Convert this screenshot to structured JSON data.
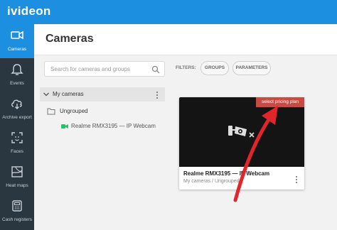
{
  "app": {
    "logo": "ivideon"
  },
  "sidebar": {
    "items": [
      {
        "label": "Cameras",
        "icon": "camera-icon",
        "active": true
      },
      {
        "label": "Events",
        "icon": "bell-icon"
      },
      {
        "label": "Archive export",
        "icon": "cloud-download-icon"
      },
      {
        "label": "Faces",
        "icon": "face-icon"
      },
      {
        "label": "Heat maps",
        "icon": "heatmap-icon"
      },
      {
        "label": "Cash registers",
        "icon": "cash-register-icon"
      }
    ]
  },
  "header": {
    "title": "Cameras"
  },
  "search": {
    "placeholder": "Search for cameras and groups",
    "value": ""
  },
  "filters": {
    "label": "FILTERS:",
    "chips": [
      "GROUPS",
      "PARAMETERS"
    ]
  },
  "tree": {
    "root": "My cameras",
    "group": "Ungrouped",
    "camera": "Realme RMX3195 — IP Webcam"
  },
  "card": {
    "badge": "select pricing plan",
    "title": "Realme RMX3195 — IP Webcam",
    "subtitle": "My cameras / Ungrouped"
  },
  "colors": {
    "accent": "#1d8fe1",
    "sidebar": "#2a3640",
    "badge": "#c94a42",
    "online": "#27c26b",
    "annotation": "#e0262b"
  }
}
